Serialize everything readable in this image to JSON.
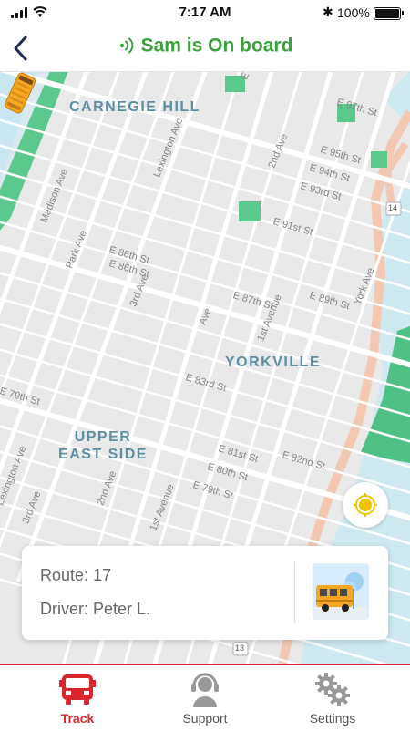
{
  "status_bar": {
    "time": "7:17 AM",
    "battery": "100%"
  },
  "header": {
    "title": "Sam is On board"
  },
  "map": {
    "neighborhoods": [
      "CARNEGIE HILL",
      "YORKVILLE",
      "UPPER EAST SIDE"
    ],
    "streets": [
      "E 97th St",
      "E 96th St",
      "E 95th St",
      "E 94th St",
      "E 93rd St",
      "E 91st St",
      "E 89th St",
      "E 87th St",
      "E 86th St",
      "E 83rd St",
      "E 82nd St",
      "E 81st St",
      "E 80th St",
      "E 79th St",
      "E 79th St",
      "2nd Ave",
      "3rd Ave",
      "Lexington Ave",
      "Park Ave",
      "Madison Ave",
      "1st Avenue",
      "York Ave",
      "Lexington Ave",
      "3rd Ave",
      "2nd Ave",
      "1st Avenue",
      "E 86th St",
      "Ave"
    ],
    "route_badges": [
      "14",
      "13"
    ]
  },
  "card": {
    "route_label": "Route:",
    "route_number": "17",
    "driver_label": "Driver:",
    "driver_name": "Peter L."
  },
  "tabs": [
    {
      "label": "Track",
      "active": true
    },
    {
      "label": "Support",
      "active": false
    },
    {
      "label": "Settings",
      "active": false
    }
  ],
  "colors": {
    "accent_red": "#d9262e",
    "onboard_green": "#3aa13c",
    "school_bus": "#f5a623",
    "header_navy": "#1b2b55"
  }
}
